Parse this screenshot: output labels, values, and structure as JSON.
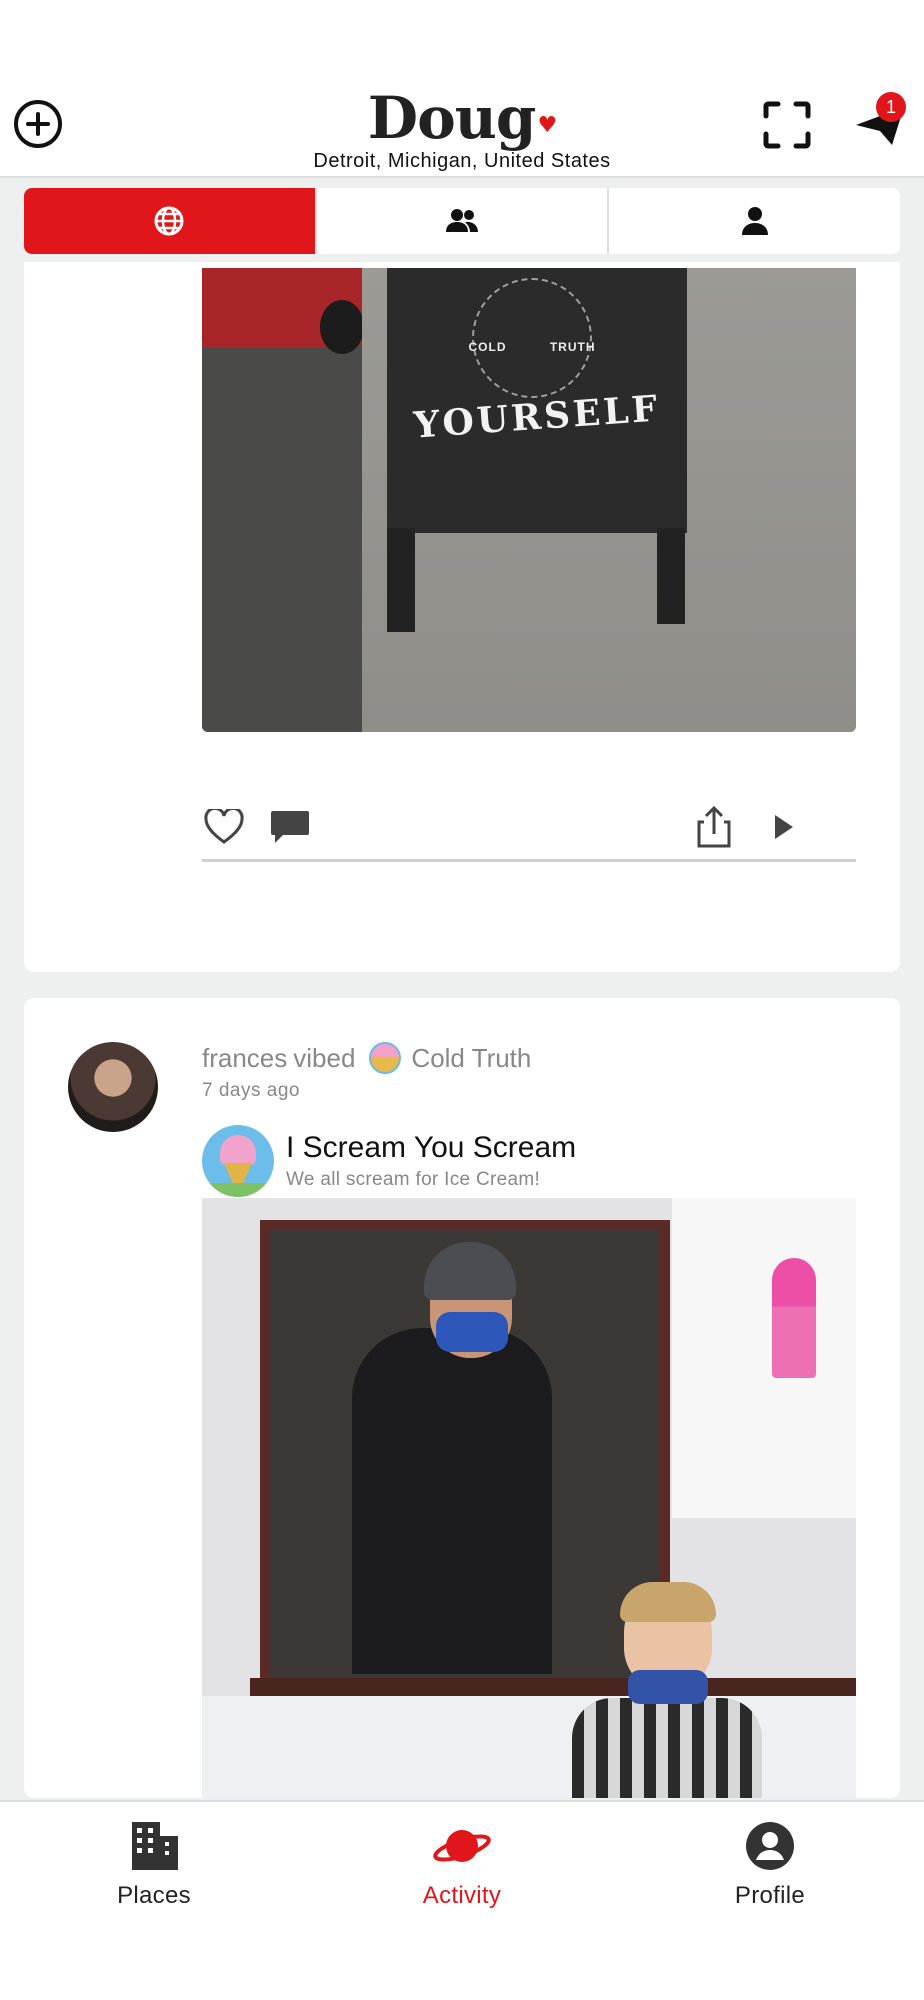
{
  "header": {
    "logo_text": "Doug",
    "location": "Detroit, Michigan, United States",
    "notification_count": "1"
  },
  "tabs": [
    {
      "icon": "globe-icon",
      "active": true
    },
    {
      "icon": "friends-icon",
      "active": false
    },
    {
      "icon": "person-icon",
      "active": false
    }
  ],
  "posts": [
    {
      "photo_text_small_left": "COLD",
      "photo_text_small_right": "TRUTH",
      "photo_text_big": "YOURSELF",
      "actions": [
        "heart-icon",
        "comment-icon",
        "share-icon",
        "play-icon"
      ]
    },
    {
      "user": "frances",
      "verb": "vibed",
      "place": "Cold Truth",
      "time": "7 days ago",
      "place_card": {
        "name": "I Scream You Scream",
        "subtitle": "We all scream for Ice Cream!"
      }
    }
  ],
  "bottom_nav": [
    {
      "label": "Places",
      "icon": "building-icon",
      "active": false
    },
    {
      "label": "Activity",
      "icon": "planet-icon",
      "active": true
    },
    {
      "label": "Profile",
      "icon": "profile-icon",
      "active": false
    }
  ],
  "colors": {
    "accent": "#e0161b",
    "background": "#eef0f0",
    "muted_text": "#888888"
  }
}
